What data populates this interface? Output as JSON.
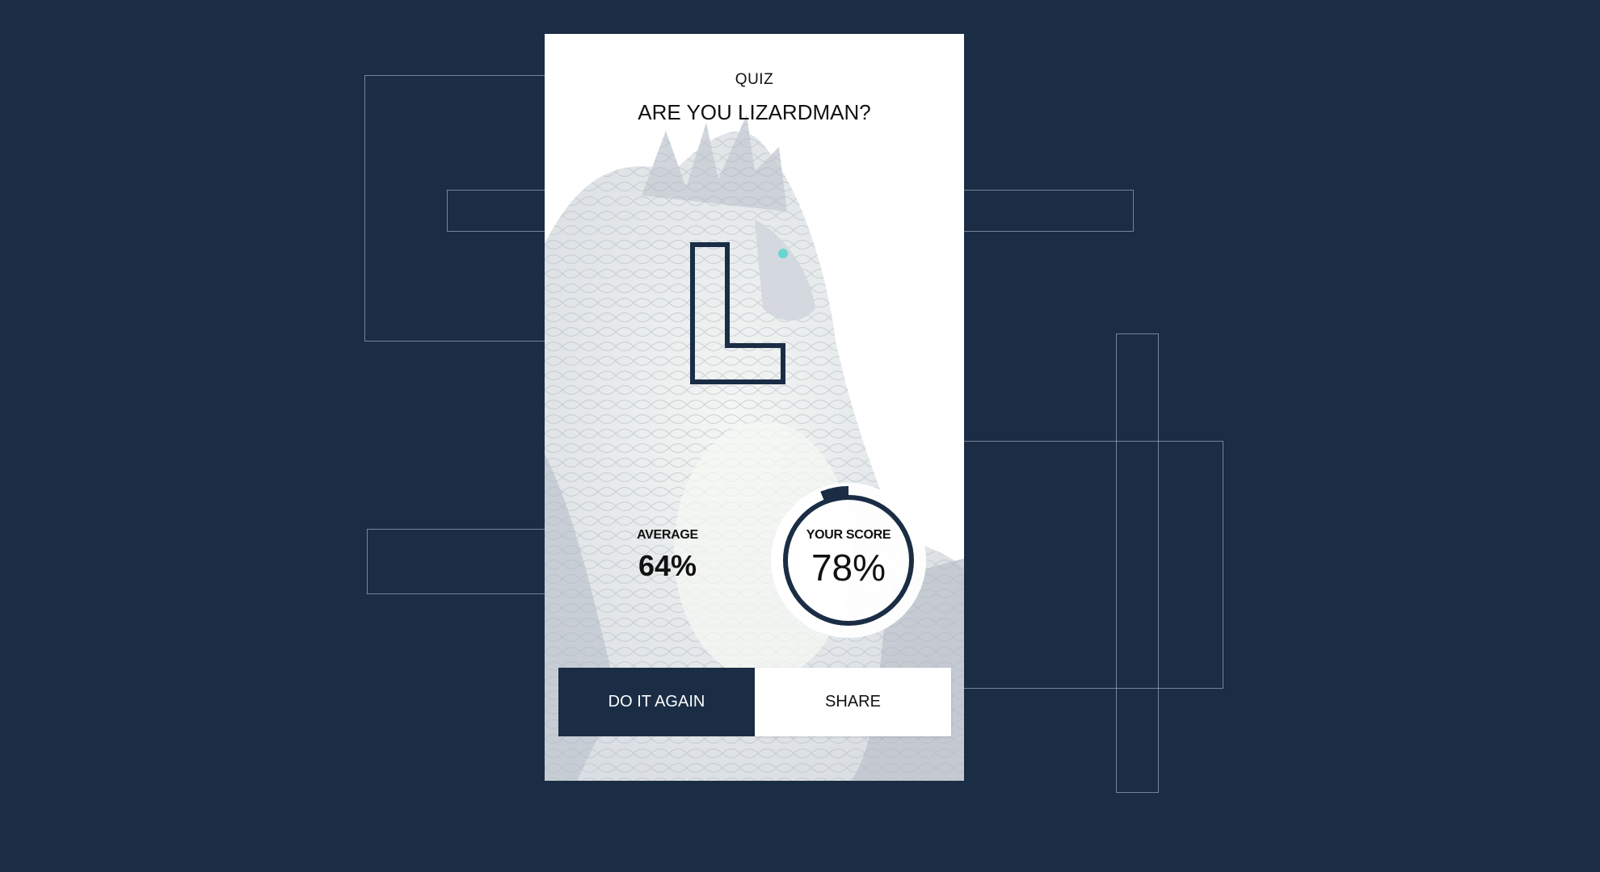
{
  "quiz": {
    "label": "QUIZ",
    "title": "ARE YOU LIZARDMAN?",
    "result_letter": "L"
  },
  "stats": {
    "average_label": "AVERAGE",
    "average_value": "64%",
    "score_label": "YOUR SCORE",
    "score_value": "78%",
    "score_progress": 0.78
  },
  "actions": {
    "again_label": "DO IT AGAIN",
    "share_label": "SHARE"
  },
  "colors": {
    "background": "#1a2d45",
    "accent": "#1a2d45",
    "card": "#ffffff"
  },
  "icons": {
    "background_art": "lizardman-dragon-illustration"
  }
}
